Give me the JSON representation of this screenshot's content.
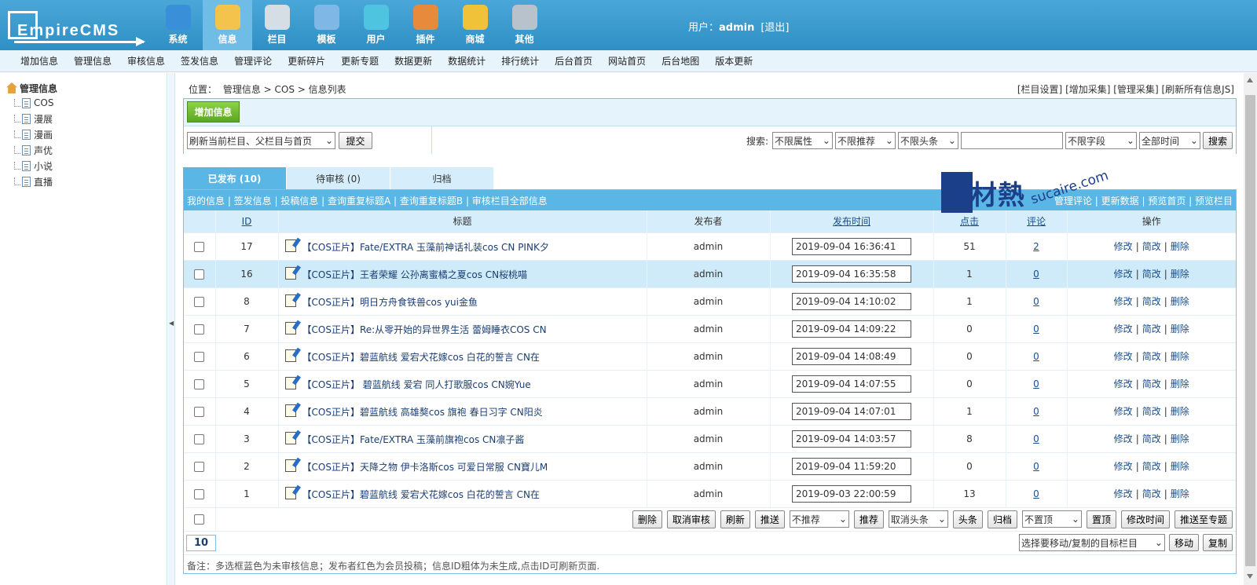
{
  "header": {
    "logo_text": "EmpireCMS",
    "nav": [
      {
        "label": "系统",
        "icon": "globe-icon",
        "color": "#3a8fd9"
      },
      {
        "label": "信息",
        "icon": "notepad-icon",
        "color": "#f3c34c",
        "active": true
      },
      {
        "label": "栏目",
        "icon": "folder-icon",
        "color": "#d5dde5"
      },
      {
        "label": "模板",
        "icon": "window-icon",
        "color": "#7fb8e6"
      },
      {
        "label": "用户",
        "icon": "user-icon",
        "color": "#4fc4e0"
      },
      {
        "label": "插件",
        "icon": "tools-icon",
        "color": "#e78a3b"
      },
      {
        "label": "商城",
        "icon": "card-icon",
        "color": "#f0c23a"
      },
      {
        "label": "其他",
        "icon": "gear-icon",
        "color": "#b8c2cc"
      }
    ],
    "user_label": "用户：",
    "user_name": "admin",
    "logout": "[退出]"
  },
  "subnav": [
    "增加信息",
    "管理信息",
    "审核信息",
    "签发信息",
    "管理评论",
    "更新碎片",
    "更新专题",
    "数据更新",
    "数据统计",
    "排行统计",
    "后台首页",
    "网站首页",
    "后台地图",
    "版本更新"
  ],
  "sidebar": {
    "root": "管理信息",
    "nodes": [
      "COS",
      "漫展",
      "漫画",
      "声优",
      "小说",
      "直播"
    ]
  },
  "location": {
    "label": "位置：",
    "path": "管理信息 > COS > 信息列表"
  },
  "top_links": [
    "[栏目设置]",
    "[增加采集]",
    "[管理采集]",
    "[刷新所有信息JS]"
  ],
  "toolbar": {
    "add_button": "增加信息",
    "refresh_select": "刷新当前栏目、父栏目与首页",
    "submit": "提交",
    "search_label": "搜索:",
    "filters": [
      "不限属性",
      "不限推荐",
      "不限头条"
    ],
    "search_placeholder": "",
    "field_select": "不限字段",
    "time_select": "全部时间",
    "search_button": "搜索"
  },
  "tabs": [
    {
      "label": "已发布 (10)",
      "active": true
    },
    {
      "label": "待审核 (0)"
    },
    {
      "label": "归档"
    }
  ],
  "links_bar_left": "我的信息 | 签发信息 | 投稿信息 | 查询重复标题A | 查询重复标题B | 审核栏目全部信息",
  "links_bar_right": "管理评论 | 更新数据 | 预览首页 | 预览栏目",
  "table": {
    "headers": {
      "id": "ID",
      "title": "标题",
      "publisher": "发布者",
      "time": "发布时间",
      "hits": "点击",
      "comments": "评论",
      "ops": "操作"
    },
    "rows": [
      {
        "id": "17",
        "title": "【COS正片】Fate/EXTRA 玉藻前神话礼装cos CN PINK夕",
        "publisher": "admin",
        "time": "2019-09-04 16:36:41",
        "hits": "51",
        "comments": "2"
      },
      {
        "id": "16",
        "title": "【COS正片】王者荣耀 公孙离蜜橘之夏cos CN桜桃喵",
        "publisher": "admin",
        "time": "2019-09-04 16:35:58",
        "hits": "1",
        "comments": "0",
        "highlight": true
      },
      {
        "id": "8",
        "title": "【COS正片】明日方舟食铁兽cos yui金鱼",
        "publisher": "admin",
        "time": "2019-09-04 14:10:02",
        "hits": "1",
        "comments": "0"
      },
      {
        "id": "7",
        "title": "【COS正片】Re:从零开始的异世界生活 蕾姆睡衣COS CN",
        "publisher": "admin",
        "time": "2019-09-04 14:09:22",
        "hits": "0",
        "comments": "0"
      },
      {
        "id": "6",
        "title": "【COS正片】碧蓝航线 爱宕犬花嫁cos 白花的誓言 CN在",
        "publisher": "admin",
        "time": "2019-09-04 14:08:49",
        "hits": "0",
        "comments": "0"
      },
      {
        "id": "5",
        "title": "【COS正片】 碧蓝航线 爱宕 同人打歌服cos CN婉Yue",
        "publisher": "admin",
        "time": "2019-09-04 14:07:55",
        "hits": "0",
        "comments": "0"
      },
      {
        "id": "4",
        "title": "【COS正片】碧蓝航线 高雄獒cos 旗袍 春日习字 CN阳炎",
        "publisher": "admin",
        "time": "2019-09-04 14:07:01",
        "hits": "1",
        "comments": "0"
      },
      {
        "id": "3",
        "title": "【COS正片】Fate/EXTRA 玉藻前旗袍cos CN凛子酱",
        "publisher": "admin",
        "time": "2019-09-04 14:03:57",
        "hits": "8",
        "comments": "0"
      },
      {
        "id": "2",
        "title": "【COS正片】天降之物 伊卡洛斯cos 可爱日常服 CN寶儿M",
        "publisher": "admin",
        "time": "2019-09-04 11:59:20",
        "hits": "0",
        "comments": "0"
      },
      {
        "id": "1",
        "title": "【COS正片】碧蓝航线 爱宕犬花嫁cos 白花的誓言 CN在",
        "publisher": "admin",
        "time": "2019-09-03 22:00:59",
        "hits": "13",
        "comments": "0"
      }
    ],
    "ops": {
      "edit": "修改",
      "simple_edit": "简改",
      "delete": "删除"
    }
  },
  "actions": {
    "delete": "删除",
    "cancel_audit": "取消审核",
    "refresh": "刷新",
    "push": "推送",
    "recommend_select": "不推荐",
    "recommend": "推荐",
    "headline_select": "取消头条",
    "headline": "头条",
    "archive": "归档",
    "top_select": "不置顶",
    "top": "置顶",
    "modify_time": "修改时间",
    "push_topic": "推送至专题"
  },
  "count": "10",
  "move": {
    "select": "选择要移动/复制的目标栏目",
    "move": "移动",
    "copy": "复制"
  },
  "note": "备注：多选框蓝色为未审核信息；发布者红色为会员投稿；信息ID粗体为未生成,点击ID可刷新页面.",
  "watermark": {
    "text": "素材熱",
    "url": "sucaire.com"
  }
}
